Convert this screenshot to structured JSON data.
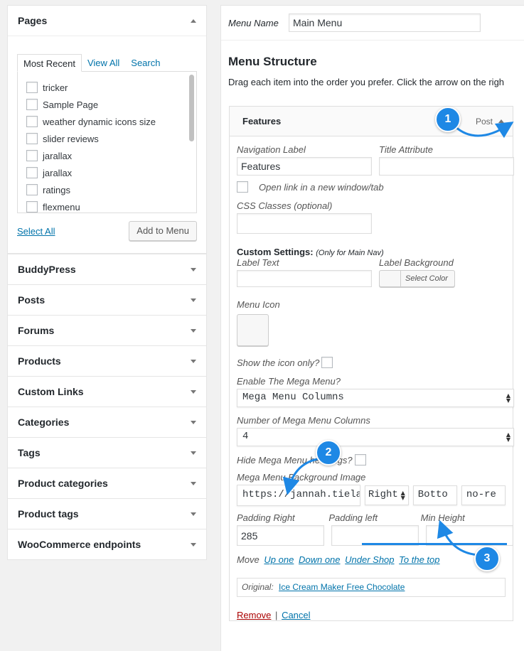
{
  "sidebar": {
    "pages": {
      "title": "Pages",
      "tabs": [
        "Most Recent",
        "View All",
        "Search"
      ],
      "items": [
        "tricker",
        "Sample Page",
        "weather dynamic icons size",
        "slider reviews",
        "jarallax",
        "jarallax",
        "ratings",
        "flexmenu"
      ],
      "select_all": "Select All",
      "add_button": "Add to Menu"
    },
    "sections": [
      "BuddyPress",
      "Posts",
      "Forums",
      "Products",
      "Custom Links",
      "Categories",
      "Tags",
      "Product categories",
      "Product tags",
      "WooCommerce endpoints"
    ]
  },
  "menu": {
    "name_label": "Menu Name",
    "name_value": "Main Menu",
    "structure_title": "Menu Structure",
    "structure_desc": "Drag each item into the order you prefer. Click the arrow on the righ",
    "item": {
      "title": "Features",
      "type": "Post",
      "nav_label_label": "Navigation Label",
      "nav_label_value": "Features",
      "title_attr_label": "Title Attribute",
      "title_attr_value": "",
      "new_window_label": "Open link in a new window/tab",
      "css_classes_label": "CSS Classes (optional)",
      "custom_settings_title": "Custom Settings:",
      "custom_settings_note": "(Only for Main Nav)",
      "label_text_label": "Label Text",
      "label_bg_label": "Label Background",
      "select_color": "Select Color",
      "menu_icon_label": "Menu Icon",
      "icon_only_label": "Show the icon only?",
      "mega_menu_label": "Enable The Mega Menu?",
      "mega_menu_value": "Mega Menu Columns",
      "columns_label": "Number of Mega Menu Columns",
      "columns_value": "4",
      "hide_headings_label": "Hide Mega Menu headings?",
      "bg_image_label": "Mega Menu Background Image",
      "bg_image_value": "https://jannah.tiela",
      "bg_pos_x": "Right",
      "bg_pos_y": "Botto",
      "bg_repeat": "no-re",
      "padding_right_label": "Padding Right",
      "padding_right_value": "285",
      "padding_left_label": "Padding left",
      "min_height_label": "Min Height",
      "move_label": "Move",
      "move_links": [
        "Up one",
        "Down one",
        "Under Shop",
        "To the top"
      ],
      "original_label": "Original:",
      "original_link": "Ice Cream Maker Free Chocolate",
      "remove": "Remove",
      "separator": "|",
      "cancel": "Cancel"
    }
  },
  "annotations": {
    "badges": [
      "1",
      "2",
      "3"
    ],
    "color": "#1e88e5"
  }
}
